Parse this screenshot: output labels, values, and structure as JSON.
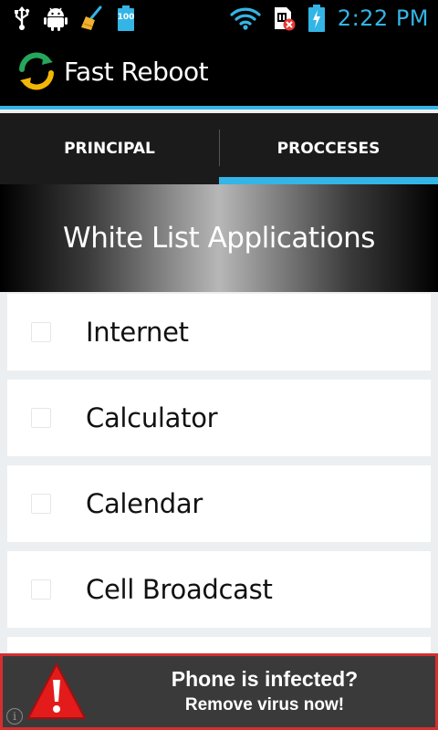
{
  "status_bar": {
    "icons_left": [
      "usb-icon",
      "android-debug-icon",
      "cleaner-broom-icon",
      "battery-100-icon"
    ],
    "battery_level_label": "100",
    "icons_right": [
      "wifi-icon",
      "sim-no-signal-icon",
      "battery-charging-icon"
    ],
    "time": "2:22 PM",
    "accent_color": "#33b5e5"
  },
  "action_bar": {
    "app_icon": "reboot-arrows-icon",
    "title": "Fast Reboot"
  },
  "tabs": [
    {
      "label": "PRINCIPAL",
      "selected": false
    },
    {
      "label": "PROCCESES",
      "selected": true
    }
  ],
  "list_header": {
    "title": "White List Applications"
  },
  "apps": [
    {
      "label": "Internet",
      "checked": false
    },
    {
      "label": "Calculator",
      "checked": false
    },
    {
      "label": "Calendar",
      "checked": false
    },
    {
      "label": "Cell Broadcast",
      "checked": false
    }
  ],
  "ad": {
    "title": "Phone is infected?",
    "subtitle": "Remove virus now!",
    "icon": "warning-triangle-icon",
    "info_icon": "info-icon",
    "info_glyph": "i",
    "border_color": "#d32f2f"
  }
}
